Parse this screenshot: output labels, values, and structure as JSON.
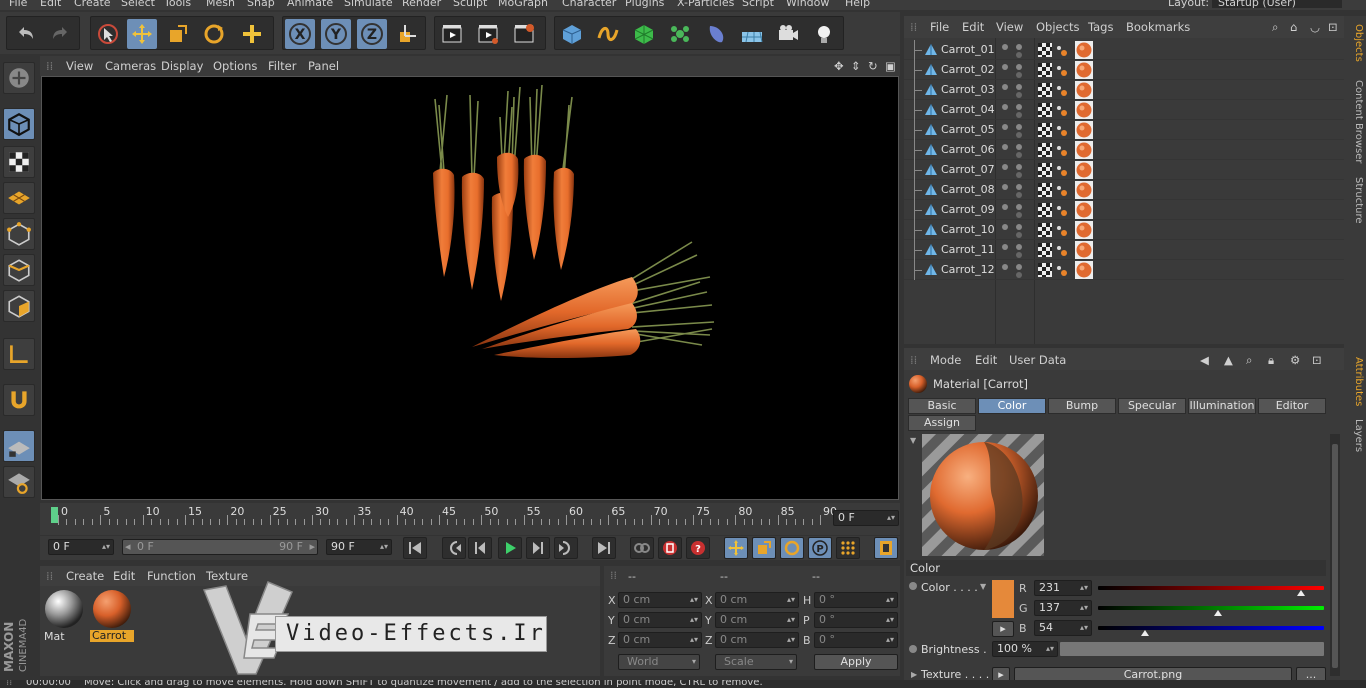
{
  "menubar": {
    "items": [
      "File",
      "Edit",
      "Create",
      "Select",
      "Tools",
      "Mesh",
      "Snap",
      "Animate",
      "Simulate",
      "Render",
      "Sculpt",
      "MoGraph",
      "Character",
      "Plugins",
      "X-Particles",
      "Script",
      "Window",
      "Help"
    ],
    "layout_label": "Layout:",
    "layout_value": "Startup (User)"
  },
  "toolbar": {
    "icons": [
      "undo-icon",
      "redo-icon",
      "live-selection-icon",
      "move-icon",
      "scale-icon",
      "rotate-icon",
      "add-icon",
      "x-axis-icon",
      "y-axis-icon",
      "z-axis-icon",
      "coordinate-system-icon",
      "render-view-icon",
      "render-picture-viewer-icon",
      "edit-render-settings-icon",
      "cube-icon",
      "spline-icon",
      "subdivision-icon",
      "cloner-icon",
      "deformer-icon",
      "floor-icon",
      "camera-icon",
      "light-icon"
    ]
  },
  "viewport": {
    "menu": [
      "View",
      "Cameras",
      "Display",
      "Options",
      "Filter",
      "Panel"
    ]
  },
  "timeline": {
    "labels": [
      "0",
      "5",
      "10",
      "15",
      "20",
      "25",
      "30",
      "35",
      "40",
      "45",
      "50",
      "55",
      "60",
      "65",
      "70",
      "75",
      "80",
      "85",
      "90"
    ],
    "current_frame": "0 F",
    "start_field": "0 F",
    "range_start": "0 F",
    "range_end": "90 F",
    "end_field": "90 F"
  },
  "material_manager": {
    "menu": [
      "Create",
      "Edit",
      "Function",
      "Texture"
    ],
    "materials": [
      {
        "name": "Mat",
        "selected": false
      },
      {
        "name": "Carrot",
        "selected": true
      }
    ]
  },
  "coordinates": {
    "headers": [
      "--",
      "--",
      "--"
    ],
    "rows": [
      {
        "a": "X",
        "av": "0 cm",
        "b": "X",
        "bv": "0 cm",
        "c": "H",
        "cv": "0 °"
      },
      {
        "a": "Y",
        "av": "0 cm",
        "b": "Y",
        "bv": "0 cm",
        "c": "P",
        "cv": "0 °"
      },
      {
        "a": "Z",
        "av": "0 cm",
        "b": "Z",
        "bv": "0 cm",
        "c": "B",
        "cv": "0 °"
      }
    ],
    "space": "World",
    "mode": "Scale",
    "apply_label": "Apply"
  },
  "watermark": {
    "text": "Video-Effects.Ir"
  },
  "maxon_logo": "MAXON CINEMA 4D",
  "status": {
    "time": "00:00:00",
    "message": "Move: Click and drag to move elements. Hold down SHIFT to quantize movement / add to the selection in point mode, CTRL to remove."
  },
  "objects_panel": {
    "menu": [
      "File",
      "Edit",
      "View",
      "Objects",
      "Tags",
      "Bookmarks"
    ],
    "objects": [
      "Carrot_01",
      "Carrot_02",
      "Carrot_03",
      "Carrot_04",
      "Carrot_05",
      "Carrot_06",
      "Carrot_07",
      "Carrot_08",
      "Carrot_09",
      "Carrot_10",
      "Carrot_11",
      "Carrot_12"
    ]
  },
  "side_tabs_top": [
    "Objects",
    "Content Browser",
    "Structure"
  ],
  "side_tabs_bottom": [
    "Attributes",
    "Layers"
  ],
  "attributes": {
    "menu": [
      "Mode",
      "Edit",
      "User Data"
    ],
    "title": "Material [Carrot]",
    "tabs": [
      "Basic",
      "Color",
      "Bump",
      "Specular",
      "Illumination",
      "Editor"
    ],
    "selected_tab": "Color",
    "assign_label": "Assign",
    "section": "Color",
    "color_label": "Color . . . .",
    "color_swatch": "#e5893a",
    "r_label": "R",
    "r_value": "231",
    "g_label": "G",
    "g_value": "137",
    "b_label": "B",
    "b_value": "54",
    "brightness_label": "Brightness .",
    "brightness_value": "100 %",
    "texture_label": "Texture . . . .",
    "texture_value": "Carrot.png",
    "more_label": "..."
  },
  "colors": {
    "accent": "#6d8fb7",
    "carrot": "#e5893a",
    "panel": "#3a3a3a"
  }
}
